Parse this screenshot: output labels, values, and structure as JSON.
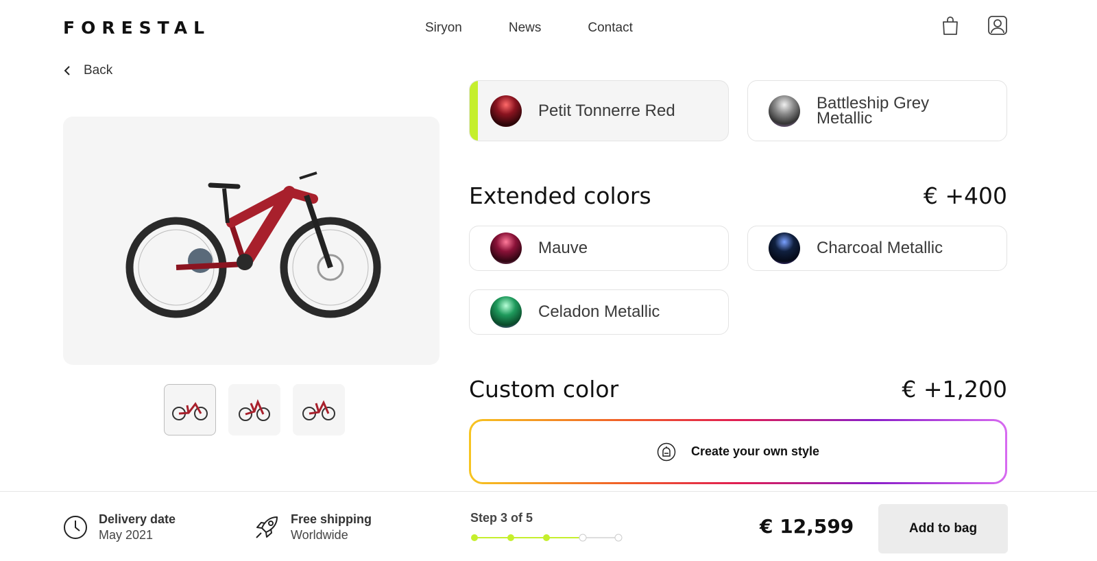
{
  "brand": {
    "logo": "FORESTAL"
  },
  "nav": {
    "items": [
      "Siryon",
      "News",
      "Contact"
    ]
  },
  "header_icons": [
    "shopping-bag-icon",
    "user-account-icon"
  ],
  "back": {
    "label": "Back"
  },
  "gallery": {
    "thumbnails": 3,
    "selected_index": 0
  },
  "standard_colors": [
    {
      "label": "Petit Tonnerre Red",
      "color": "#8b1420",
      "selected": true
    },
    {
      "label": "Battleship Grey Metallic",
      "color": "#6e6e6e",
      "selected": false
    }
  ],
  "extended": {
    "title": "Extended colors",
    "price": "€ +400",
    "options": [
      {
        "label": "Mauve",
        "color": "#8a1238"
      },
      {
        "label": "Charcoal Metallic",
        "color": "#10203f"
      },
      {
        "label": "Celadon Metallic",
        "color": "#1f9a5c"
      }
    ]
  },
  "custom": {
    "title": "Custom color",
    "price": "€ +1,200",
    "button_label": "Create your own style"
  },
  "footer": {
    "delivery_title": "Delivery date",
    "delivery_value": "May 2021",
    "shipping_title": "Free shipping",
    "shipping_value": "Worldwide",
    "step_label": "Step 3 of 5",
    "step_current": 3,
    "step_total": 5,
    "total_price": "€ 12,599",
    "add_to_bag": "Add to bag"
  },
  "colors": {
    "accent": "#c5ef2d",
    "frame_red": "#a8202c"
  }
}
